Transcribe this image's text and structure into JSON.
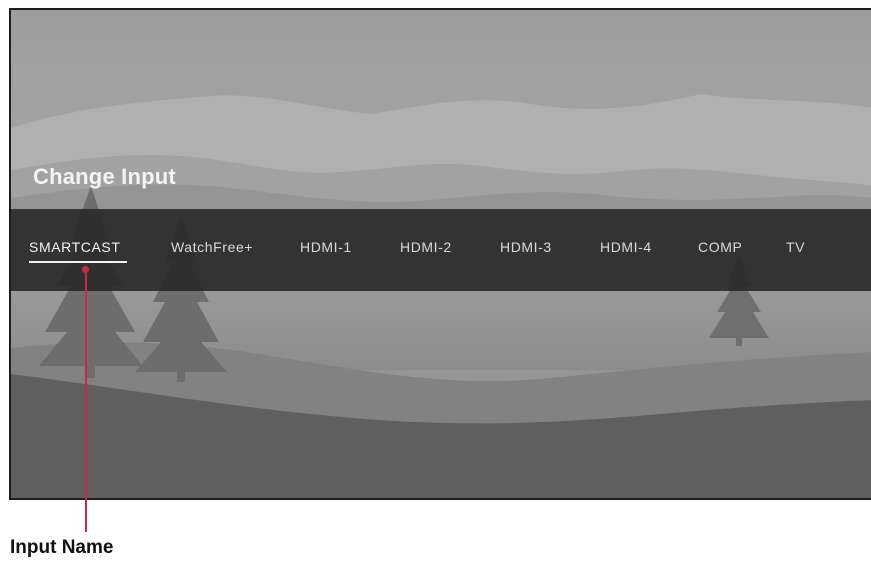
{
  "screen": {
    "title": "Change Input"
  },
  "inputs": [
    {
      "label": "SMARTCAST",
      "selected": true
    },
    {
      "label": "WatchFree+",
      "selected": false
    },
    {
      "label": "HDMI-1",
      "selected": false
    },
    {
      "label": "HDMI-2",
      "selected": false
    },
    {
      "label": "HDMI-3",
      "selected": false
    },
    {
      "label": "HDMI-4",
      "selected": false
    },
    {
      "label": "COMP",
      "selected": false
    },
    {
      "label": "TV",
      "selected": false
    }
  ],
  "callout": {
    "label": "Input Name",
    "color": "#c8284a"
  },
  "colors": {
    "bar": "#282828",
    "text": "#d9d9d9",
    "selected_text": "#f2f2f2"
  }
}
